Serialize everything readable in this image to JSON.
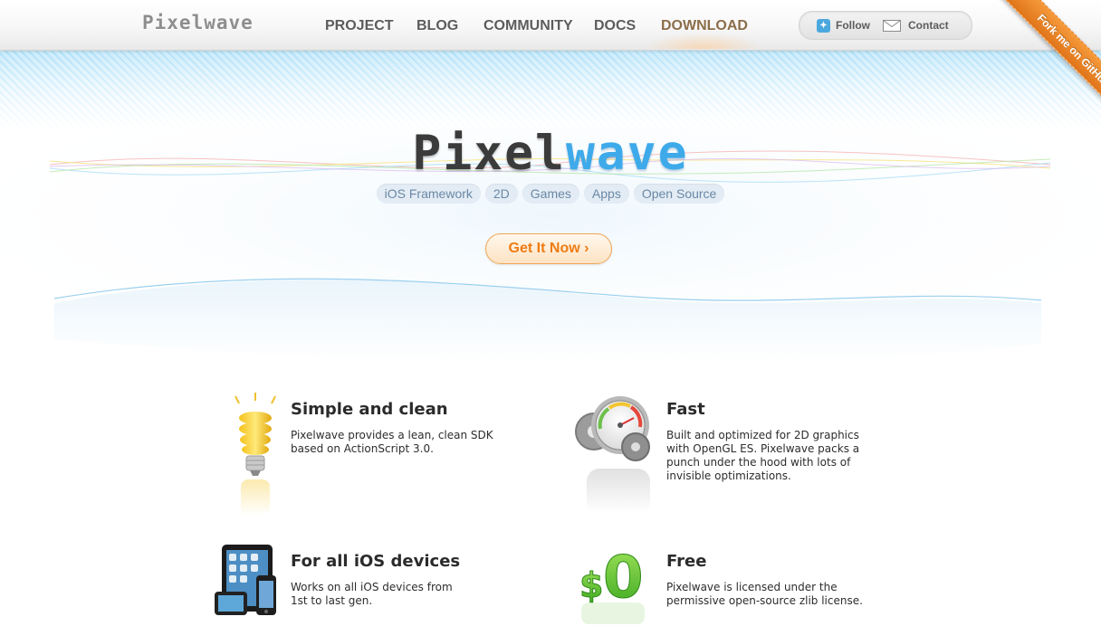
{
  "nav": {
    "logo": "Pixelwave",
    "items": [
      {
        "label": "PROJECT",
        "active": false
      },
      {
        "label": "BLOG",
        "active": false
      },
      {
        "label": "COMMUNITY",
        "active": false
      },
      {
        "label": "DOCS",
        "active": false
      },
      {
        "label": "DOWNLOAD",
        "active": true
      }
    ],
    "follow_label": "Follow",
    "contact_label": "Contact",
    "ribbon_label": "Fork me on GitHub"
  },
  "hero": {
    "logo_dark": "Pixel",
    "logo_blue": "wave",
    "tags": [
      "iOS Framework",
      "2D",
      "Games",
      "Apps",
      "Open Source"
    ],
    "cta_label": "Get It Now ›"
  },
  "features": [
    {
      "title": "Simple and clean",
      "icon": "lightbulb-icon",
      "lines": [
        "Pixelwave provides a lean, clean SDK",
        "based on ActionScript 3.0."
      ]
    },
    {
      "title": "Fast",
      "icon": "speedometer-gear-icon",
      "lines": [
        "Built and optimized for 2D graphics",
        "with OpenGL ES. Pixelwave packs a",
        "punch under the hood with lots of",
        "invisible optimizations."
      ]
    },
    {
      "title": "For all iOS devices",
      "icon": "ios-devices-icon",
      "lines": [
        "Works on all iOS devices from",
        "1st to last gen."
      ]
    },
    {
      "title": "Free",
      "icon": "dollar-zero-icon",
      "lines": [
        "Pixelwave is licensed under the",
        "permissive open-source zlib license."
      ]
    }
  ],
  "colors": {
    "accent_orange": "#ee7c14",
    "logo_blue": "#3eaaea",
    "nav_text": "#5c5c5c",
    "nav_active": "#8b6d4a",
    "tag_bg": "#e3ecf4"
  }
}
